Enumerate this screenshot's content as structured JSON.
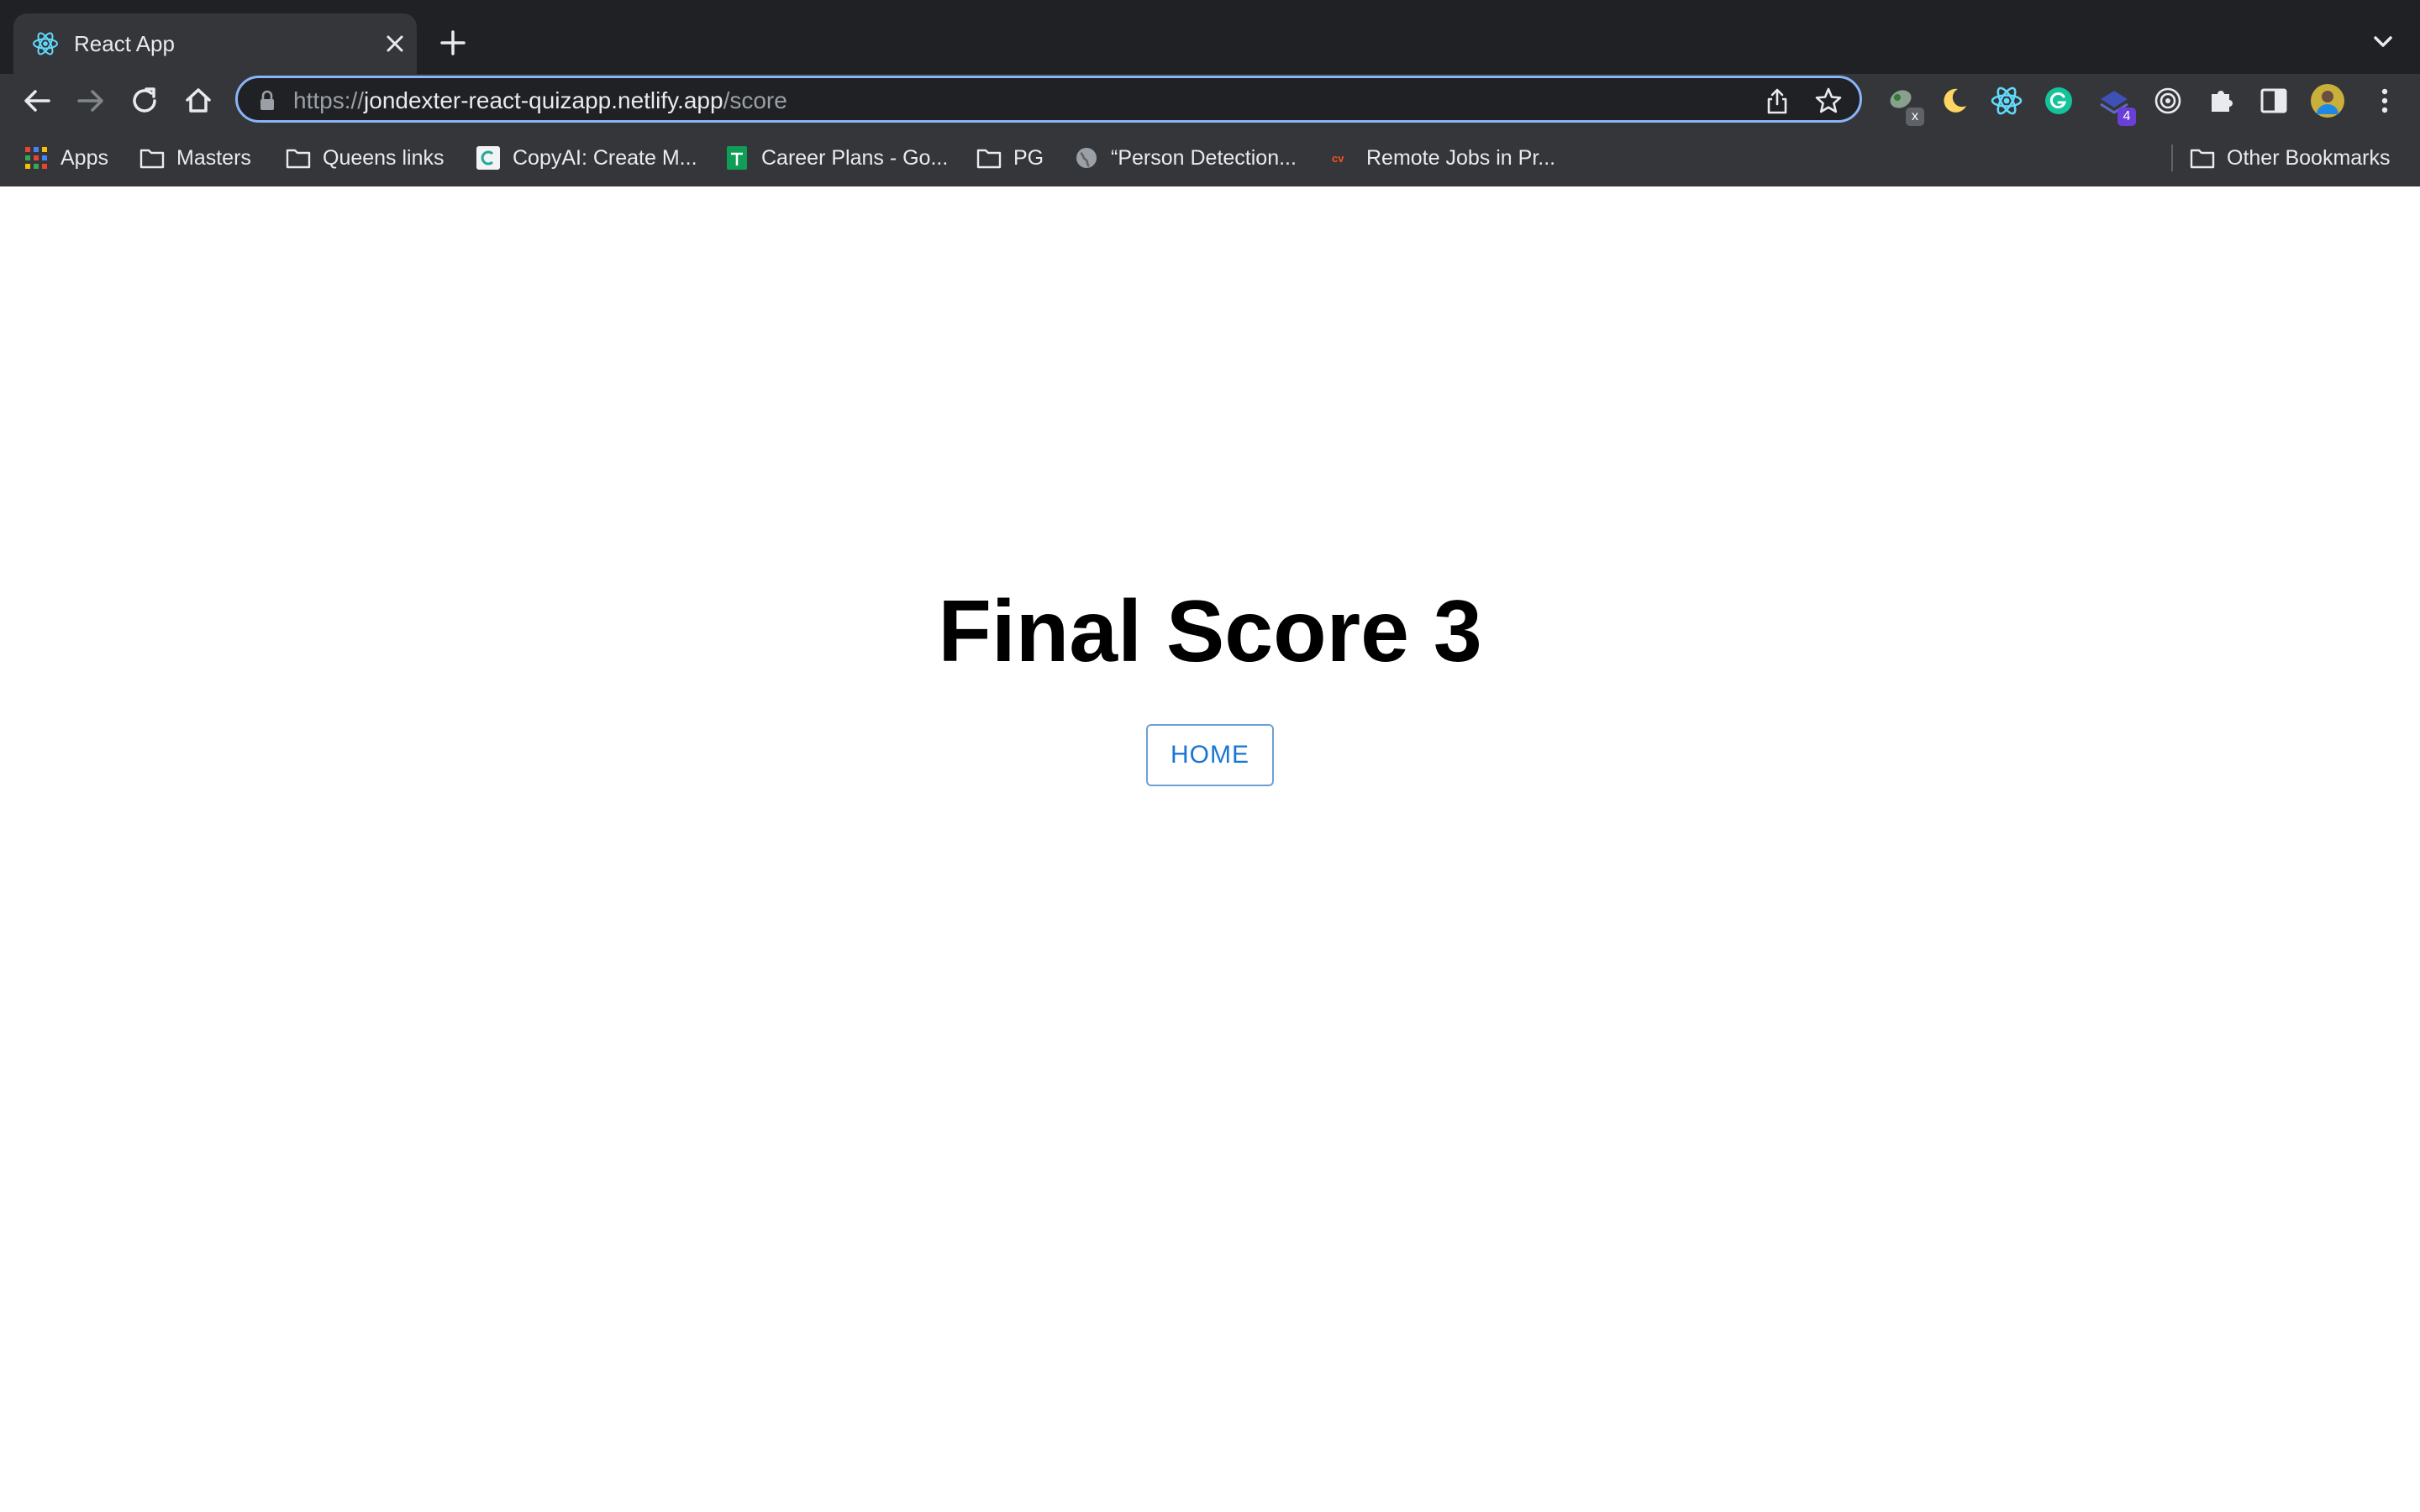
{
  "browser": {
    "tab": {
      "title": "React App",
      "icon": "react-logo-icon"
    },
    "address_bar": {
      "url_scheme": "https://",
      "url_host": "jondexter-react-quizapp.netlify.app",
      "url_path": "/score"
    },
    "extension_badges": {
      "pasang": "x",
      "stack": "4"
    },
    "bookmarks": [
      {
        "label": "Apps",
        "icon": "apps-grid-icon"
      },
      {
        "label": "Masters",
        "icon": "folder-icon"
      },
      {
        "label": "Queens links",
        "icon": "folder-icon"
      },
      {
        "label": "CopyAI: Create M...",
        "icon": "copyai-icon"
      },
      {
        "label": "Career Plans - Go...",
        "icon": "sheets-icon"
      },
      {
        "label": "PG",
        "icon": "folder-icon"
      },
      {
        "label": "“Person Detection...",
        "icon": "globe-icon"
      },
      {
        "label": "Remote Jobs in Pr...",
        "icon": "cv-icon"
      }
    ],
    "other_bookmarks": "Other Bookmarks"
  },
  "page": {
    "score_title": "Final Score 3",
    "home_button": "HOME"
  },
  "colors": {
    "tabstrip": "#202124",
    "toolbar": "#35363a",
    "omnibox_focus": "#8ab4f8",
    "button_text": "#1976d2",
    "button_border": "#6e9fd6"
  }
}
